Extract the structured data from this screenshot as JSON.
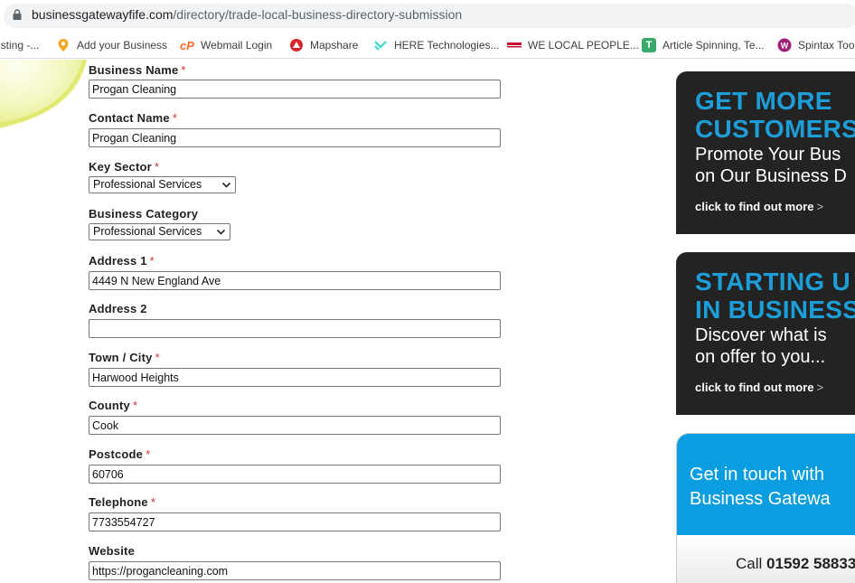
{
  "browser": {
    "url_host": "businessgatewayfife.com",
    "url_path": "/directory/trade-local-business-directory-submission",
    "bookmarks": [
      {
        "label": "isting -...",
        "icon": "none"
      },
      {
        "label": "Add your Business",
        "icon": "location-pin-icon"
      },
      {
        "label": "Webmail Login",
        "icon": "cpanel-icon"
      },
      {
        "label": "Mapshare",
        "icon": "mapshare-icon"
      },
      {
        "label": "HERE Technologies...",
        "icon": "here-icon"
      },
      {
        "label": "WE LOCAL PEOPLE...",
        "icon": "flag-icon"
      },
      {
        "label": "Article Spinning, Te...",
        "icon": "t-icon"
      },
      {
        "label": "Spintax Too",
        "icon": "spintax-icon"
      }
    ]
  },
  "form": {
    "business_name": {
      "label": "Business Name",
      "required": "*",
      "value": "Progan Cleaning"
    },
    "contact_name": {
      "label": "Contact Name",
      "required": "*",
      "value": "Progan Cleaning"
    },
    "key_sector": {
      "label": "Key Sector",
      "required": "*",
      "value": "Professional Services"
    },
    "business_category": {
      "label": "Business Category",
      "value": "Professional Services"
    },
    "address1": {
      "label": "Address 1",
      "required": "*",
      "value": "4449 N New England Ave"
    },
    "address2": {
      "label": "Address 2",
      "value": ""
    },
    "town": {
      "label": "Town / City",
      "required": "*",
      "value": "Harwood Heights"
    },
    "county": {
      "label": "County",
      "required": "*",
      "value": "Cook"
    },
    "postcode": {
      "label": "Postcode",
      "required": "*",
      "value": "60706"
    },
    "telephone": {
      "label": "Telephone",
      "required": "*",
      "value": "7733554727"
    },
    "website": {
      "label": "Website",
      "value": "https://progancleaning.com"
    }
  },
  "sidebar": {
    "ad1": {
      "heading1": "GET MORE",
      "heading2": "CUSTOMERS",
      "sub1": "Promote Your Bus",
      "sub2": "on Our Business D",
      "cta": "click to find out more",
      "cta_arrow": ">"
    },
    "ad2": {
      "heading1": "STARTING U",
      "heading2": "IN BUSINESS",
      "sub1": "Discover what is",
      "sub2": "on offer to you...",
      "cta": "click to find out more",
      "cta_arrow": ">"
    },
    "contact": {
      "line1": "Get in touch with",
      "line2": "Business Gatewa",
      "call_label": "Call",
      "phone": "01592 58833"
    }
  },
  "colors": {
    "accent_blue": "#1e9ed8",
    "banner_dark": "#232323",
    "contact_blue": "#0a9de0",
    "required_red": "#d0312d"
  }
}
